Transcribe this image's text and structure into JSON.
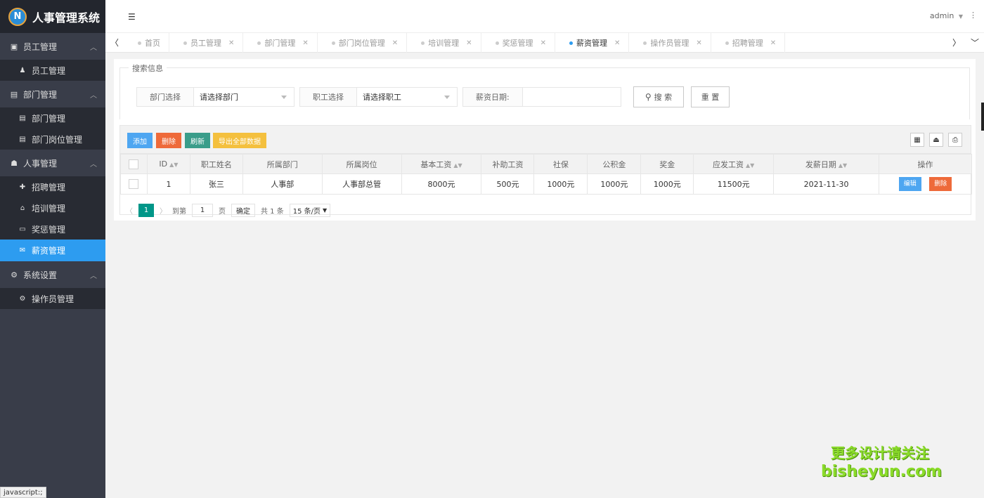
{
  "app": {
    "title": "人事管理系统",
    "logo_text": "N"
  },
  "header": {
    "user": "admin",
    "menu_icon": "☰"
  },
  "sidebar": {
    "groups": [
      {
        "label": "员工管理",
        "icon": "user-card-icon",
        "items": [
          {
            "label": "员工管理",
            "icon": "person-icon"
          }
        ]
      },
      {
        "label": "部门管理",
        "icon": "id-card-icon",
        "items": [
          {
            "label": "部门管理",
            "icon": "id-card-icon"
          },
          {
            "label": "部门岗位管理",
            "icon": "id-card-icon"
          }
        ]
      },
      {
        "label": "人事管理",
        "icon": "users-icon",
        "items": [
          {
            "label": "招聘管理",
            "icon": "user-plus-icon"
          },
          {
            "label": "培训管理",
            "icon": "graduation-cap-icon"
          },
          {
            "label": "奖惩管理",
            "icon": "monitor-icon"
          },
          {
            "label": "薪资管理",
            "icon": "envelope-icon",
            "active": true
          }
        ]
      },
      {
        "label": "系统设置",
        "icon": "gears-icon",
        "items": [
          {
            "label": "操作员管理",
            "icon": "gears-icon"
          }
        ]
      }
    ]
  },
  "tabs": [
    {
      "label": "首页",
      "closable": false
    },
    {
      "label": "员工管理",
      "closable": true
    },
    {
      "label": "部门管理",
      "closable": true
    },
    {
      "label": "部门岗位管理",
      "closable": true
    },
    {
      "label": "培训管理",
      "closable": true
    },
    {
      "label": "奖惩管理",
      "closable": true
    },
    {
      "label": "薪资管理",
      "closable": true,
      "active": true
    },
    {
      "label": "操作员管理",
      "closable": true
    },
    {
      "label": "招聘管理",
      "closable": true
    }
  ],
  "search": {
    "legend": "搜索信息",
    "dept_label": "部门选择",
    "dept_value": "请选择部门",
    "emp_label": "职工选择",
    "emp_value": "请选择职工",
    "date_label": "薪资日期:",
    "date_value": "",
    "search_button": "搜 索",
    "reset_button": "重 置"
  },
  "toolbar": {
    "add": "添加",
    "delete": "删除",
    "refresh": "刷新",
    "export": "导出全部数据"
  },
  "table": {
    "columns": [
      "ID",
      "职工姓名",
      "所属部门",
      "所属岗位",
      "基本工资",
      "补助工资",
      "社保",
      "公积金",
      "奖金",
      "应发工资",
      "发薪日期",
      "操作"
    ],
    "rows": [
      {
        "id": "1",
        "name": "张三",
        "dept": "人事部",
        "post": "人事部总管",
        "base": "8000元",
        "subsidy": "500元",
        "social": "1000元",
        "fund": "1000元",
        "bonus": "1000元",
        "total": "11500元",
        "date": "2021-11-30",
        "edit": "编辑",
        "del": "删除"
      }
    ]
  },
  "pager": {
    "current": "1",
    "goto_label": "到第",
    "page_input": "1",
    "page_unit": "页",
    "confirm": "确定",
    "total": "共 1 条",
    "page_size": "15 条/页"
  },
  "status_bar": "javascript:;",
  "watermark": {
    "line1": "更多设计请关注",
    "line2": "bisheyun.com"
  },
  "colors": {
    "sidebar_bg": "#393d49",
    "active": "#2d9cf0",
    "add": "#4ea6f1",
    "danger": "#ee6a3a",
    "refresh": "#3a9d8a",
    "export": "#f4c03e",
    "page_current": "#009688"
  }
}
